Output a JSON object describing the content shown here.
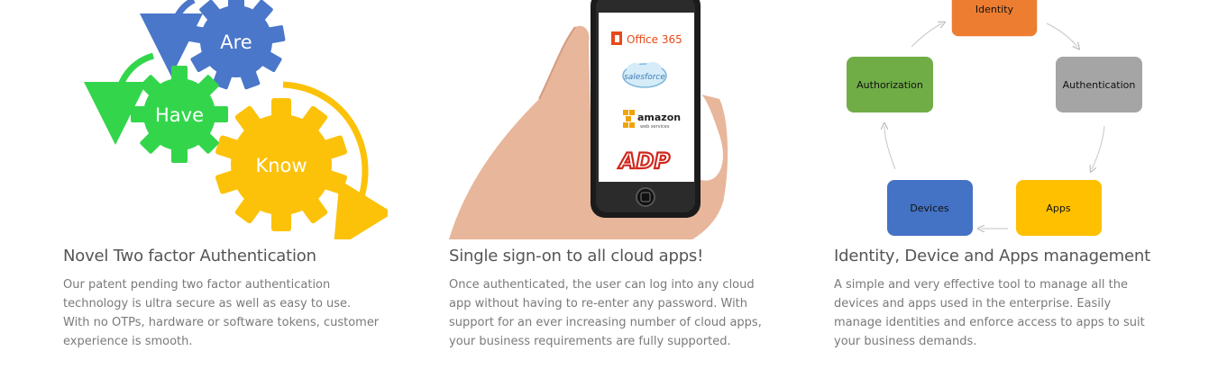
{
  "features": [
    {
      "title": "Novel Two factor Authentication",
      "description": "Our patent pending two factor authentication technology is ultra secure as well as easy to use. With no OTPs, hardware or software tokens, customer experience is smooth.",
      "gears": {
        "are": "Are",
        "have": "Have",
        "know": "Know"
      },
      "colors": {
        "are": "#4a77c9",
        "have": "#33d64b",
        "know": "#fcc20a"
      }
    },
    {
      "title": "Single sign-on to all cloud apps!",
      "description": "Once authenticated, the user can log into any cloud app without having to re-enter any password. With support for an ever increasing number of cloud apps, your business requirements are fully supported.",
      "apps": {
        "office": "Office 365",
        "salesforce": "salesforce",
        "amazon": "amazon",
        "amazon_sub": "web services",
        "adp": "ADP"
      }
    },
    {
      "title": "Identity, Device and Apps management",
      "description": "A simple and very effective tool to manage all the devices and apps used in the enterprise. Easily manage identities and enforce access to apps to suit your business demands.",
      "cycle": {
        "identity": "Identity",
        "authorization": "Authorization",
        "authentication": "Authentication",
        "devices": "Devices",
        "apps": "Apps"
      },
      "colors": {
        "identity": "#ed7d31",
        "authorization": "#70ad47",
        "authentication": "#a5a5a5",
        "devices": "#4472c4",
        "apps": "#ffc000"
      }
    }
  ]
}
